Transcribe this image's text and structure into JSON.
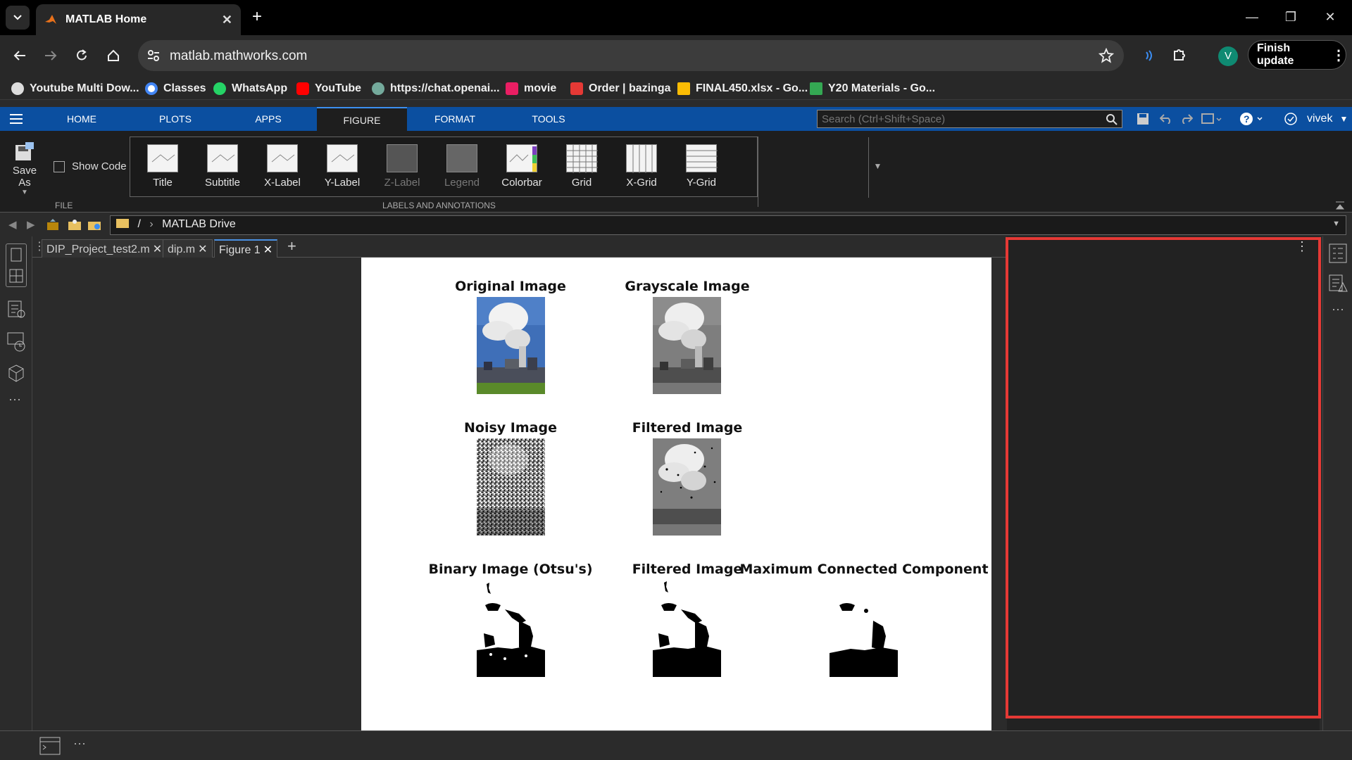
{
  "browser": {
    "tab_title": "MATLAB Home",
    "url": "matlab.mathworks.com",
    "finish_update": "Finish update",
    "profile_initial": "V"
  },
  "bookmarks": [
    {
      "label": "Youtube Multi Dow...",
      "color": "#dddddd"
    },
    {
      "label": "Classes",
      "color": "#4285f4"
    },
    {
      "label": "WhatsApp",
      "color": "#25d366"
    },
    {
      "label": "YouTube",
      "color": "#ff0000"
    },
    {
      "label": "https://chat.openai...",
      "color": "#74aa9c"
    },
    {
      "label": "movie",
      "color": "#e91e63"
    },
    {
      "label": "Order | bazinga",
      "color": "#e53935"
    },
    {
      "label": "FINAL450.xlsx - Go...",
      "color": "#fbbc04"
    },
    {
      "label": "Y20 Materials - Go...",
      "color": "#34a853"
    }
  ],
  "matlab": {
    "tabs": [
      "HOME",
      "PLOTS",
      "APPS",
      "FIGURE",
      "FORMAT",
      "TOOLS"
    ],
    "active_tab": "FIGURE",
    "search_placeholder": "Search (Ctrl+Shift+Space)",
    "user": "vivek",
    "file_section": "FILE",
    "save_as": "Save As",
    "show_code": "Show Code",
    "gallery_section": "LABELS AND ANNOTATIONS",
    "gallery": [
      {
        "label": "Title",
        "enabled": true
      },
      {
        "label": "Subtitle",
        "enabled": true
      },
      {
        "label": "X-Label",
        "enabled": true
      },
      {
        "label": "Y-Label",
        "enabled": true
      },
      {
        "label": "Z-Label",
        "enabled": false
      },
      {
        "label": "Legend",
        "enabled": false
      },
      {
        "label": "Colorbar",
        "enabled": true
      },
      {
        "label": "Grid",
        "enabled": true
      },
      {
        "label": "X-Grid",
        "enabled": true
      },
      {
        "label": "Y-Grid",
        "enabled": true
      }
    ],
    "path": {
      "root": "/",
      "folder": "MATLAB Drive"
    },
    "doc_tabs": [
      "DIP_Project_test2.m",
      "dip.m",
      "Figure 1"
    ],
    "active_doc": "Figure 1"
  },
  "figure": {
    "panels": [
      {
        "title": "Original Image",
        "kind": "color"
      },
      {
        "title": "Grayscale Image",
        "kind": "gray"
      },
      {
        "title": "Noisy Image",
        "kind": "noisy"
      },
      {
        "title": "Filtered Image",
        "kind": "filtered"
      },
      {
        "title": "Binary Image (Otsu's)",
        "kind": "binary"
      },
      {
        "title": "Filtered Image",
        "kind": "binary"
      },
      {
        "title": "Maximum Connected Component",
        "kind": "component"
      }
    ]
  },
  "colors": {
    "accent": "#0b4fa0",
    "highlight_border": "#e53935"
  }
}
